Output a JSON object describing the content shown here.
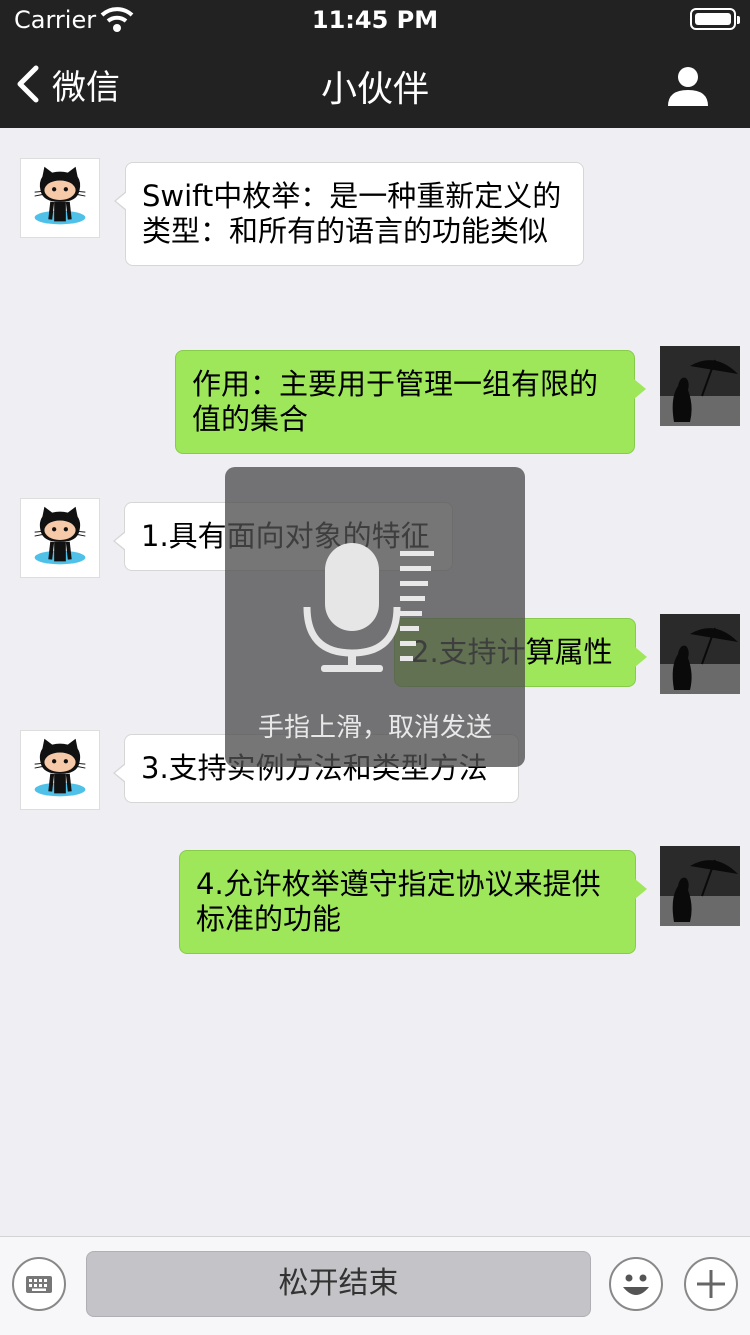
{
  "status_bar": {
    "carrier": "Carrier",
    "time": "11:45 PM"
  },
  "nav": {
    "back_label": "微信",
    "title": "小伙伴"
  },
  "messages": [
    {
      "side": "left",
      "avatar": "github-octocat-avatar",
      "text": "Swift中枚举：是一种重新定义的类型：和所有的语言的功能类似"
    },
    {
      "side": "right",
      "avatar": "umbrella-dog-photo-avatar",
      "text": "作用：主要用于管理一组有限的值的集合"
    },
    {
      "side": "left",
      "avatar": "github-octocat-avatar",
      "text": "1.具有面向对象的特征"
    },
    {
      "side": "right",
      "avatar": "umbrella-dog-photo-avatar",
      "text": "2.支持计算属性"
    },
    {
      "side": "left",
      "avatar": "github-octocat-avatar",
      "text": "3.支持实例方法和类型方法"
    },
    {
      "side": "right",
      "avatar": "umbrella-dog-photo-avatar",
      "text": "4.允许枚举遵守指定协议来提供标准的功能"
    }
  ],
  "recording": {
    "hint": "手指上滑，取消发送",
    "level_count": 8
  },
  "input_bar": {
    "talk_label": "松开结束"
  },
  "colors": {
    "nav_bg": "#222222",
    "bubble_right": "#9ee75a",
    "bubble_left": "#ffffff",
    "chat_bg": "#eeeef3"
  }
}
